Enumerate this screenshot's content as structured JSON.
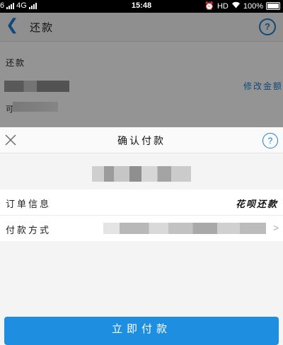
{
  "status_bar": {
    "carrier_left": "6",
    "network": "4G",
    "time": "15:48",
    "hd": "HD",
    "battery": "100%"
  },
  "background_page": {
    "title": "还款",
    "help_icon": "?",
    "section_label": "还款",
    "edit_amount_label": "修改金额",
    "available_label": "可"
  },
  "sheet": {
    "title": "确认付款",
    "help_icon": "?",
    "rows": [
      {
        "label": "订单信息",
        "value": "花呗还款"
      },
      {
        "label": "付款方式",
        "value": ""
      }
    ],
    "pay_button": "立即付款"
  },
  "colors": {
    "accent": "#1e8fe0",
    "link": "#1a7fd0"
  }
}
